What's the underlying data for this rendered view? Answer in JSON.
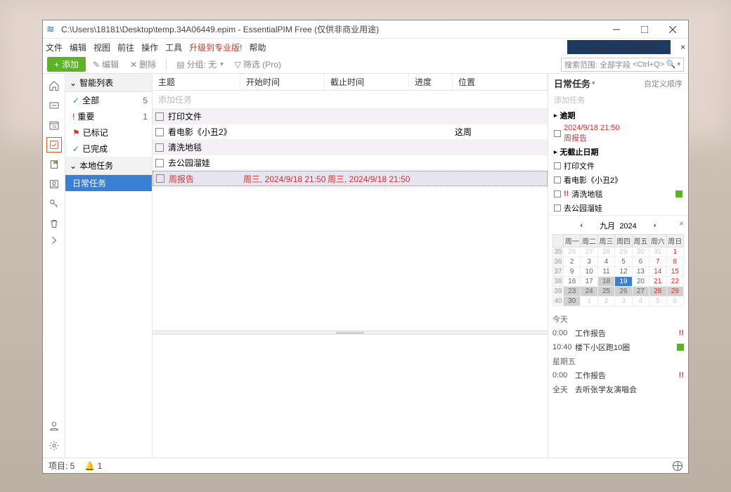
{
  "window": {
    "title": "C:\\Users\\18181\\Desktop\\temp.34A06449.epim - EssentialPIM Free (仅供非商业用途)"
  },
  "menu": {
    "file": "文件",
    "edit": "编辑",
    "view": "视图",
    "go": "前往",
    "actions": "操作",
    "tools": "工具",
    "upgrade": "升级到专业版!",
    "help": "帮助"
  },
  "cloud": {
    "label": "Apple iCloud 同步"
  },
  "toolbar": {
    "add": "添加",
    "edit": "编辑",
    "delete": "删除",
    "group": "分组: 无",
    "filter": "筛选 (Pro)"
  },
  "search": {
    "placeholder": "搜索范围: 全部字段",
    "hint": "<Ctrl+Q>"
  },
  "tree": {
    "sec_smart": "智能列表",
    "sec_local": "本地任务",
    "all": "全部",
    "all_cnt": "5",
    "important": "重要",
    "important_cnt": "1",
    "flagged": "已标记",
    "done": "已完成",
    "daily": "日常任务"
  },
  "columns": {
    "subject": "主题",
    "start": "开始时间",
    "due": "截止时间",
    "progress": "进度",
    "location": "位置"
  },
  "addrow": "添加任务",
  "rows": [
    {
      "sub": "打印文件",
      "alt": true
    },
    {
      "sub": "看电影《小丑2》",
      "loc": "这周"
    },
    {
      "sub": "清洗地毯",
      "alt": true
    },
    {
      "sub": "去公园溜娃"
    },
    {
      "sub": "周报告",
      "start": "周三, 2024/9/18 21:50",
      "due": "周三, 2024/9/18 21:50",
      "red": true,
      "sel": true
    }
  ],
  "right": {
    "title": "日常任务",
    "order": "自定义顺序",
    "add": "添加任务",
    "sec_overdue": "逾期",
    "overdue_dt": "2024/9/18 21:50",
    "overdue_name": "周报告",
    "sec_nodue": "无截止日期",
    "items": [
      {
        "t": "打印文件"
      },
      {
        "t": "看电影《小丑2》"
      },
      {
        "t": "清洗地毯",
        "imp": true,
        "green": true
      },
      {
        "t": "去公园溜娃"
      }
    ]
  },
  "cal": {
    "month": "九月",
    "year": "2024",
    "dow": [
      "周一",
      "周二",
      "周三",
      "周四",
      "周五",
      "周六",
      "周日"
    ],
    "weeks": [
      {
        "wk": "35",
        "d": [
          "26",
          "27",
          "28",
          "29",
          "30",
          "31",
          "1"
        ],
        "om": [
          0,
          1,
          2,
          3,
          4,
          5
        ]
      },
      {
        "wk": "36",
        "d": [
          "2",
          "3",
          "4",
          "5",
          "6",
          "7",
          "8"
        ]
      },
      {
        "wk": "37",
        "d": [
          "9",
          "10",
          "11",
          "12",
          "13",
          "14",
          "15"
        ]
      },
      {
        "wk": "38",
        "d": [
          "16",
          "17",
          "18",
          "19",
          "20",
          "21",
          "22"
        ],
        "sel": [
          2
        ],
        "today": 3
      },
      {
        "wk": "39",
        "d": [
          "23",
          "24",
          "25",
          "26",
          "27",
          "28",
          "29"
        ],
        "selall": true
      },
      {
        "wk": "40",
        "d": [
          "30",
          "1",
          "2",
          "3",
          "4",
          "5",
          "6"
        ],
        "sel": [
          0
        ],
        "om": [
          1,
          2,
          3,
          4,
          5,
          6
        ]
      }
    ]
  },
  "agenda": {
    "today": "今天",
    "rows1": [
      {
        "tm": "0:00",
        "tx": "工作报告",
        "imp": true
      },
      {
        "tm": "10:40",
        "tx": "楼下小区跑10圈",
        "green": true
      }
    ],
    "friday": "星期五",
    "rows2": [
      {
        "tm": "0:00",
        "tx": "工作报告",
        "imp": true
      },
      {
        "tm": "全天",
        "tx": "去听张学友演唱会"
      }
    ]
  },
  "status": {
    "items": "项目: 5",
    "bell": "1"
  }
}
